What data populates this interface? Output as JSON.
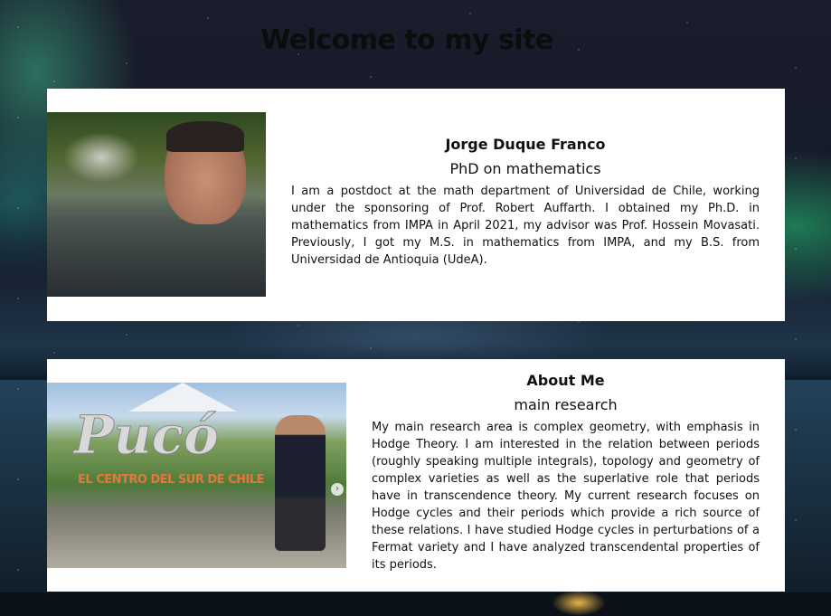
{
  "page": {
    "title": "Welcome to my site"
  },
  "profile": {
    "name": "Jorge Duque Franco",
    "subtitle": "PhD on mathematics",
    "bio": "I am a postdoct at the math department of Universidad de Chile, working under the sponsoring of Prof. Robert Auffarth. I obtained my Ph.D. in mathematics from IMPA in April 2021, my advisor was Prof. Hossein Movasati. Previously, I got my M.S. in mathematics from IMPA, and my B.S. from Universidad de Antioquia (UdeA)."
  },
  "about": {
    "heading": "About Me",
    "subtitle": "main research",
    "text": "My main research area is complex geometry, with emphasis in Hodge Theory. I am interested in the relation between periods (roughly speaking multiple integrals), topology and geometry of complex varieties as well as the superlative role that periods have in transcendence theory. My current research focuses on Hodge cycles and their periods which provide a rich source of these relations. I have studied Hodge cycles in perturbations of a Fermat variety and I have analyzed transcendental properties of its periods.",
    "photo_sign": "Pucó",
    "photo_sign_sub": "EL CENTRO DEL SUR DE CHILE",
    "carousel_next": "›"
  }
}
